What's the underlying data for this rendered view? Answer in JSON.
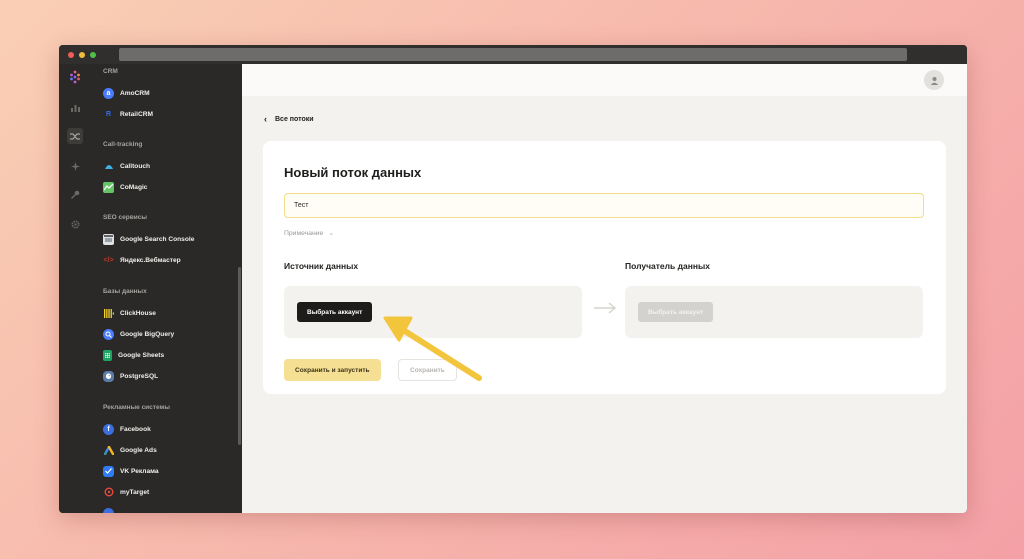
{
  "sidebar": {
    "sections": [
      {
        "title": "CRM",
        "items": [
          {
            "label": "AmoCRM",
            "icon": "amocrm-icon",
            "color": "#4a7cff"
          },
          {
            "label": "RetailCRM",
            "icon": "retailcrm-icon",
            "color": "#2f6dff"
          }
        ]
      },
      {
        "title": "Call-tracking",
        "items": [
          {
            "label": "Calltouch",
            "icon": "calltouch-icon",
            "color": "#3fb0e6"
          },
          {
            "label": "CoMagic",
            "icon": "comagic-icon",
            "color": "#65c466"
          }
        ]
      },
      {
        "title": "SEO сервисы",
        "items": [
          {
            "label": "Google Search Console",
            "icon": "google-search-console-icon",
            "color": "#9aa0a6"
          },
          {
            "label": "Яндекс.Вебмастер",
            "icon": "yandex-webmaster-icon",
            "color": "#c0392b"
          }
        ]
      },
      {
        "title": "Базы данных",
        "items": [
          {
            "label": "ClickHouse",
            "icon": "clickhouse-icon",
            "color": "#f5d22b"
          },
          {
            "label": "Google BigQuery",
            "icon": "bigquery-icon",
            "color": "#4a7cff"
          },
          {
            "label": "Google Sheets",
            "icon": "google-sheets-icon",
            "color": "#20a464"
          },
          {
            "label": "PostgreSQL",
            "icon": "postgresql-icon",
            "color": "#5a7ca8"
          }
        ]
      },
      {
        "title": "Рекламные системы",
        "items": [
          {
            "label": "Facebook",
            "icon": "facebook-icon",
            "color": "#3b6fe0"
          },
          {
            "label": "Google Ads",
            "icon": "google-ads-icon",
            "color": "#f3b823"
          },
          {
            "label": "VK Реклама",
            "icon": "vk-ads-icon",
            "color": "#2f7cf6"
          },
          {
            "label": "myTarget",
            "icon": "mytarget-icon",
            "color": "#e84a3a"
          }
        ]
      }
    ]
  },
  "main": {
    "back_label": "Все потоки",
    "card_title": "Новый поток данных",
    "name_value": "Тест",
    "note_label": "Примечание",
    "source_label": "Источник данных",
    "destination_label": "Получатель данных",
    "source_button": "Выбрать аккаунт",
    "destination_button": "Выбрать аккаунт",
    "save_run_button": "Сохранить и запустить",
    "save_button": "Сохранить"
  },
  "colors": {
    "accent_yellow": "#f5df92",
    "pointer_arrow": "#f2c53d",
    "sidebar_bg": "#2a2927"
  }
}
